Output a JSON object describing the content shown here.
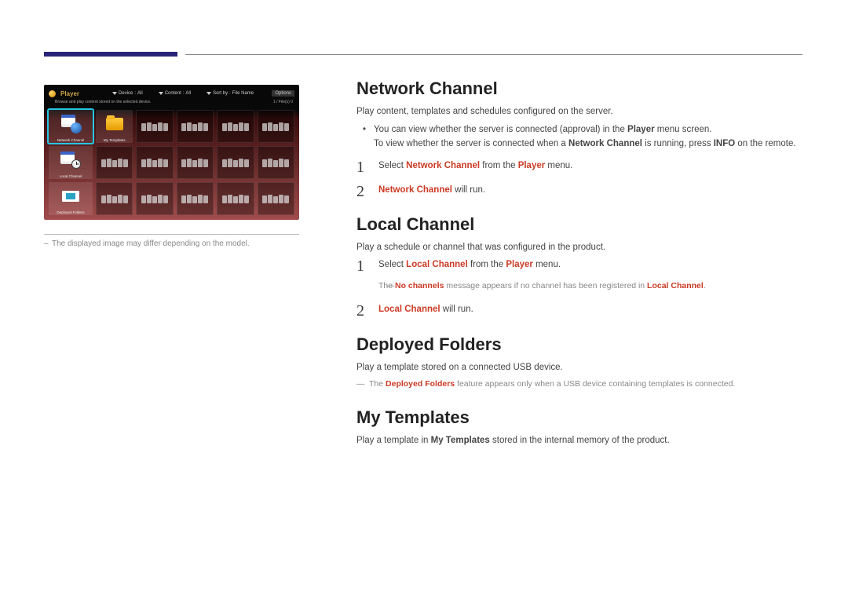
{
  "panel": {
    "title": "Player",
    "dropdowns": [
      {
        "label": "Device",
        "value": "All"
      },
      {
        "label": "Content",
        "value": "All"
      },
      {
        "label": "Sort by",
        "value": "File Name"
      }
    ],
    "option_label": "Options",
    "subtext_left": "Browse and play content stored on the selected device.",
    "subtext_right": "1 / File(s) 0",
    "special_cells": [
      {
        "label": "Network Channel"
      },
      {
        "label": "My Templates"
      },
      {
        "label": "Local Channel"
      },
      {
        "label": "Deployed Folders"
      }
    ]
  },
  "panel_note": "The displayed image may differ depending on the model.",
  "sections": {
    "network": {
      "title": "Network Channel",
      "subtitle": "Play content, templates and schedules configured on the server.",
      "bullet1_a": "You can view whether the server is connected (approval) in the ",
      "bullet1_b": "Player",
      "bullet1_c": " menu screen.",
      "bullet2_a": "To view whether the server is connected when a ",
      "bullet2_b": "Network Channel",
      "bullet2_c": " is running, press ",
      "bullet2_d": "INFO",
      "bullet2_e": " on the remote.",
      "step1_a": "Select ",
      "step1_b": "Network Channel",
      "step1_c": " from the ",
      "step1_d": "Player",
      "step1_e": " menu.",
      "step2_a": "Network Channel",
      "step2_b": " will run."
    },
    "local": {
      "title": "Local Channel",
      "subtitle": "Play a schedule or channel that was configured in the product.",
      "step1_a": "Select ",
      "step1_b": "Local Channel",
      "step1_c": " from the ",
      "step1_d": "Player",
      "step1_e": " menu.",
      "note_a": "The ",
      "note_b": "No channels",
      "note_c": " message appears if no channel has been registered in ",
      "note_d": "Local Channel",
      "note_e": ".",
      "step2_a": "Local Channel",
      "step2_b": " will run."
    },
    "deployed": {
      "title": "Deployed Folders",
      "subtitle": "Play a template stored on a connected USB device.",
      "note_a": "The ",
      "note_b": "Deployed Folders",
      "note_c": " feature appears only when a USB device containing templates is connected."
    },
    "templates": {
      "title": "My Templates",
      "sub_a": "Play a template in ",
      "sub_b": "My Templates",
      "sub_c": " stored in the internal memory of the product."
    }
  }
}
